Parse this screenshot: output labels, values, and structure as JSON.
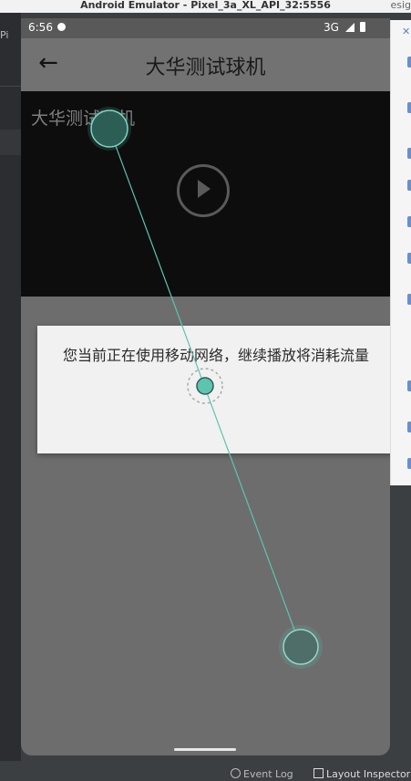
{
  "window": {
    "title": "Android Emulator - Pixel_3a_XL_API_32:5556",
    "side_fragment": "esig"
  },
  "ide": {
    "left_tab_fragment": "Pi",
    "bottom": {
      "event_log": "Event Log",
      "layout_inspector": "Layout Inspector"
    }
  },
  "status_bar": {
    "time": "6:56",
    "network": "3G"
  },
  "app_bar": {
    "title": "大华测试球机"
  },
  "video": {
    "title": "大华测试球机"
  },
  "dialog": {
    "message": "您当前正在使用移动网络，继续播放将消耗流量"
  },
  "colors": {
    "gesture_accent": "#5ec4b0",
    "dim_overlay": "#6d6d6d",
    "dialog_bg": "#f1f1f1",
    "video_bg": "#0d0d0d"
  },
  "icons": {
    "back": "arrow-back-icon",
    "play": "play-circle-icon",
    "notification": "chat-bubble-icon",
    "signal": "signal-icon",
    "battery": "battery-icon"
  }
}
